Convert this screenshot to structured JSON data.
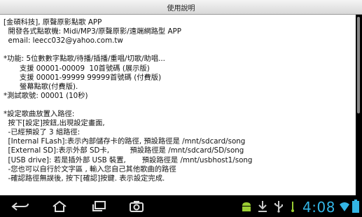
{
  "window": {
    "title": "使用說明"
  },
  "content": {
    "lines": [
      "[金碩科技], 原聲原影點歌 APP",
      "  開發各式點歌機: Midi/MP3/原聲原影/遠端網路型 APP",
      "  email: leecc032@yahoo.com.tw",
      "",
      "*功能: 5位數數字點歌/待播/插播/重唱/切歌/助唱...",
      "       支援 00001-00009  10首號碼 (展示版)",
      "       支援 00001-99999 99999首號碼 (付費版)",
      "       螢幕點歌(付費版).",
      "*測試歌號: 00001 (10秒)",
      "",
      "*設定歌曲放置入路徑:",
      "  按下[設定]按鈕,出現設定畫面,",
      "  -已經預設了 3 組路徑:",
      "  [Internal FLash]:表示內部儲存卡的路徑, 預設路徑是 /mnt/sdcard/song",
      "  [External SD]:表示外部 SD卡,         預設路徑是 /mnt/sdcard/SD/song",
      "  [USB drive]: 若是插外部 USB 裝置,       預設路徑是 /mnt/usbhost1/song",
      "  -您也可以自行於文字區 , 輸入您自己其他歌曲的路徑",
      "  -確認路徑無誤後, 按下[確認]按鍵. 表示設定完成."
    ]
  },
  "statusbar": {
    "time": "4:08",
    "accent": "#33b5e5"
  },
  "navbar": {
    "icons": [
      "back-icon",
      "home-icon",
      "recent-apps-icon",
      "screenshot-icon",
      "android-debug-icon",
      "download-icon",
      "usb-icon",
      "wifi-icon",
      "battery-icon"
    ]
  }
}
